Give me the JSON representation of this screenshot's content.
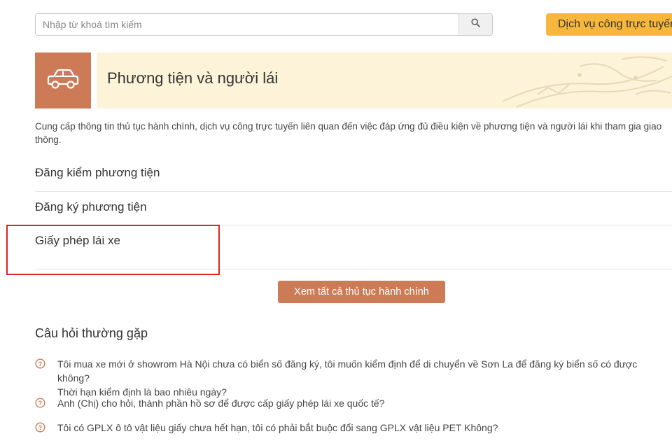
{
  "search": {
    "placeholder": "Nhập từ khoá tìm kiếm",
    "icon": "search-icon"
  },
  "header": {
    "online_service_label": "Dịch vụ công trực tuyến"
  },
  "hero": {
    "title": "Phương tiện và người lái",
    "icon": "car-icon",
    "accent_color": "#cd7b56",
    "banner_color": "#fdf3d8"
  },
  "intro": "Cung cấp thông tin thủ tục hành chính, dịch vụ công trực tuyến liên quan đến việc đáp ứng đủ điều kiện về phương tiện và người lái khi tham gia giao thông.",
  "categories": [
    {
      "label": "Đăng kiểm phương tiện"
    },
    {
      "label": "Đăng ký phương tiện"
    },
    {
      "label": "Giấy phép lái xe"
    }
  ],
  "view_all_label": "Xem tất cả thủ tục hành chính",
  "faq": {
    "heading": "Câu hỏi thường gặp",
    "icon": "question-circle-icon",
    "items": [
      {
        "text": "Tôi mua xe mới ở showrom Hà Nội chưa có biển số đăng ký, tôi muốn kiểm định để di chuyển về Sơn La để đăng ký biển số có được không?\nThời hạn kiểm định là bao nhiêu ngày?"
      },
      {
        "text": "Anh (Chị) cho hỏi, thành phần hồ sơ để được cấp giấy phép lái xe quốc tế?"
      },
      {
        "text": "Tôi có GPLX ô tô vật liệu giấy chưa hết hạn, tôi có phải bắt buộc đổi sang GPLX vật liệu PET Không?"
      }
    ]
  }
}
